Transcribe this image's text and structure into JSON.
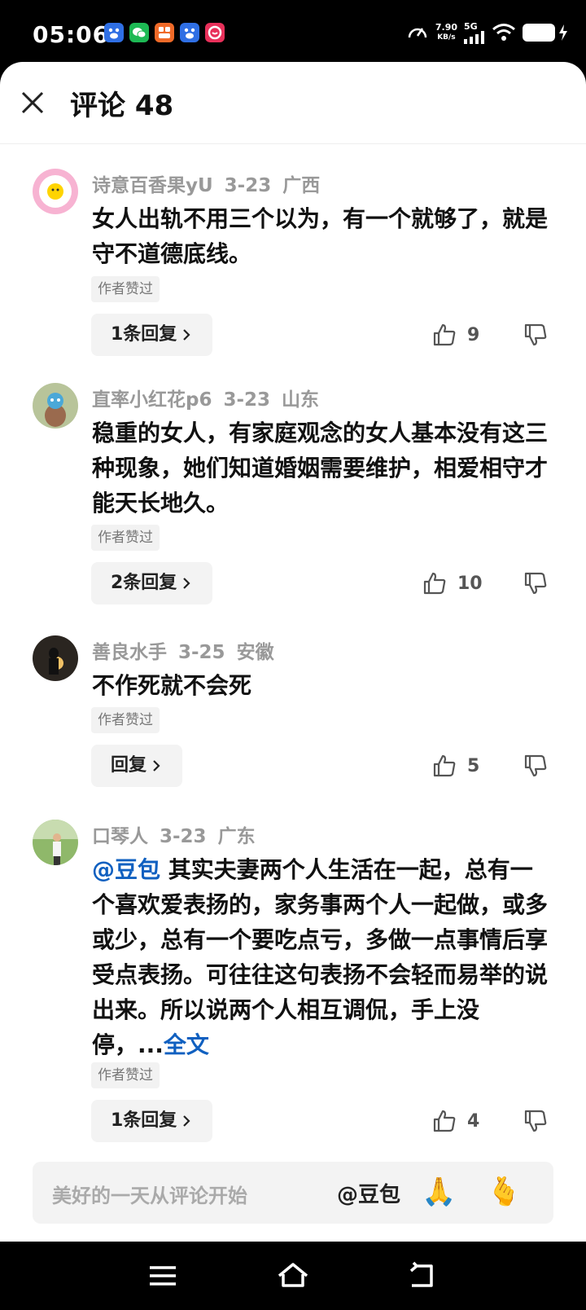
{
  "status_bar": {
    "time": "05:06",
    "net_speed_value": "7.90",
    "net_speed_unit": "KB/s",
    "network": "5G",
    "app_icons": [
      "baidu-icon",
      "wechat-icon",
      "orange-app-icon",
      "baidu-icon",
      "pink-app-icon"
    ]
  },
  "header": {
    "title": "评论 48"
  },
  "comments": [
    {
      "username": "诗意百香果yU",
      "date": "3-23",
      "region": "广西",
      "text": "女人出轨不用三个以为，有一个就够了，就是守不道德底线。",
      "badge": "作者赞过",
      "reply_label": "1条回复",
      "likes": "9"
    },
    {
      "username": "直率小红花p6",
      "date": "3-23",
      "region": "山东",
      "text": "稳重的女人，有家庭观念的女人基本没有这三种现象，她们知道婚姻需要维护，相爱相守才能天长地久。",
      "badge": "作者赞过",
      "reply_label": "2条回复",
      "likes": "10"
    },
    {
      "username": "善良水手",
      "date": "3-25",
      "region": "安徽",
      "text": "不作死就不会死",
      "badge": "作者赞过",
      "reply_label": "回复",
      "likes": "5"
    },
    {
      "username": "口琴人",
      "date": "3-23",
      "region": "广东",
      "mention": "@豆包",
      "text": " 其实夫妻两个人生活在一起，总有一个喜欢爱表扬的，家务事两个人一起做，或多或少，总有一个要吃点亏，多做一点事情后享受点表扬。可往往这句表扬不会轻而易举的说出来。所以说两个人相互调侃，手上没停，...",
      "more": "全文",
      "badge": "作者赞过",
      "reply_label": "1条回复",
      "likes": "4"
    }
  ],
  "input_bar": {
    "placeholder": "美好的一天从评论开始",
    "mention_button": "@豆包",
    "emoji_1": "🙏",
    "emoji_2": "🫰"
  },
  "colors": {
    "link": "#1060c0",
    "meta": "#999999",
    "text": "#111111"
  }
}
